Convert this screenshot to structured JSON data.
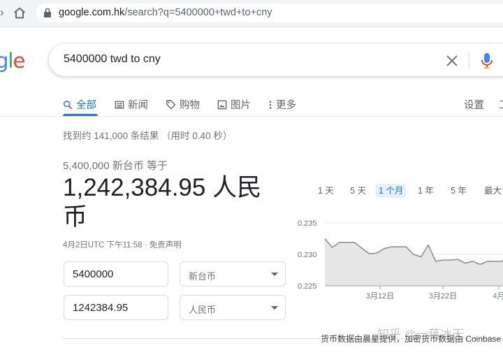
{
  "browser": {
    "url_host": "google.com.hk",
    "url_path": "/search?q=5400000+twd+to+cny"
  },
  "google": {
    "logo_partial": [
      "g",
      "l",
      "e"
    ],
    "logo_colors": [
      "#4285F4",
      "#34A853",
      "#EA4335"
    ],
    "query": "5400000 twd to cny",
    "tabs": [
      {
        "label": "全部",
        "icon": "search-icon",
        "active": true
      },
      {
        "label": "新闻",
        "icon": "news-icon"
      },
      {
        "label": "购物",
        "icon": "tag-icon"
      },
      {
        "label": "图片",
        "icon": "image-icon"
      },
      {
        "label": "更多",
        "icon": "more-vert-icon"
      }
    ],
    "settings": "设置",
    "tools": "工",
    "result_stats": "找到约 141,000 条结果 （用时 0.40 秒）"
  },
  "converter": {
    "from_line": "5,400,000 新台币 等于",
    "result_line1": "1,242,384.95 人民",
    "result_line2": "币",
    "timestamp": "4月2日UTC 下午11:58 · 免责声明",
    "from_amount": "5400000",
    "from_currency": "新台币",
    "to_amount": "1242384.95",
    "to_currency": "人民币"
  },
  "chart": {
    "ranges": [
      "1 天",
      "5 天",
      "1 个月",
      "1 年",
      "5 年",
      "最大"
    ],
    "active_range": "1 个月",
    "source": "货币数据由晨星提供，加密货币数据由 Coinbase",
    "accent": "#1a73e8"
  },
  "chart_data": {
    "type": "area",
    "y_ticks": [
      "0.235",
      "0.230",
      "0.225"
    ],
    "x_ticks": [
      "3月12日",
      "3月22日",
      "4月"
    ],
    "ylim": [
      0.225,
      0.235
    ],
    "values": [
      0.2325,
      0.2311,
      0.2319,
      0.2319,
      0.2319,
      0.231,
      0.2301,
      0.2302,
      0.2309,
      0.2312,
      0.2312,
      0.2312,
      0.23,
      0.2296,
      0.2315,
      0.2289,
      0.2291,
      0.2291,
      0.2292,
      0.2286,
      0.2289,
      0.2284,
      0.2289,
      0.2289,
      0.2289,
      0.2301,
      0.2301,
      0.23
    ],
    "grid": true
  },
  "watermark": "知乎 @一蒋冰天"
}
